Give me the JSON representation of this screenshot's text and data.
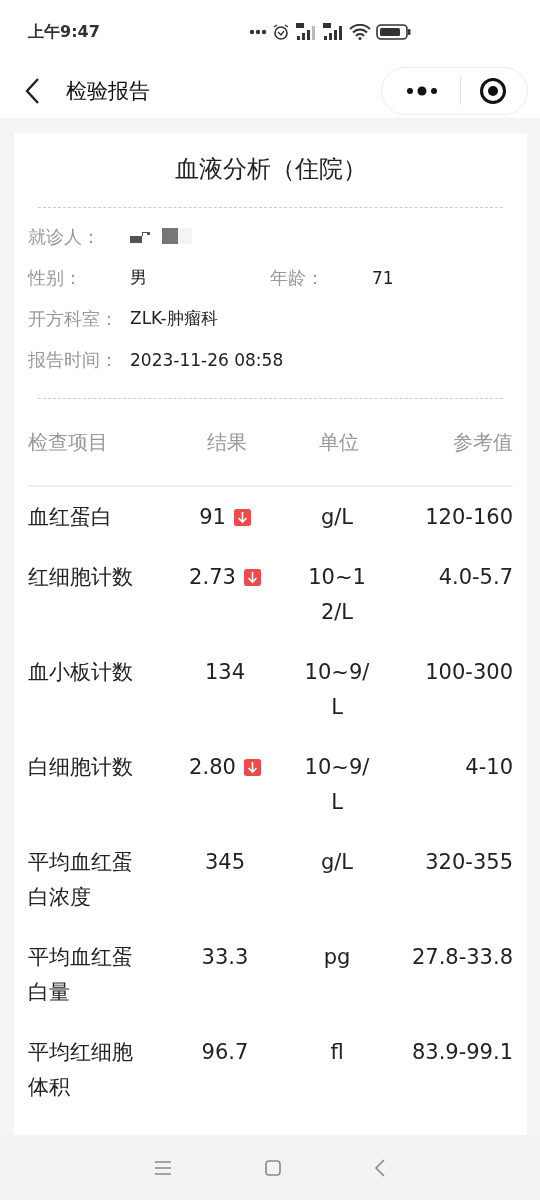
{
  "status_bar": {
    "time": "上午9:47"
  },
  "nav": {
    "title": "检验报告"
  },
  "report": {
    "title": "血液分析（住院）",
    "info": [
      {
        "label": "就诊人：",
        "kind": "redacted"
      },
      {
        "label": "性别：",
        "value": "男",
        "label2": "年龄：",
        "value2": "71",
        "kind": "pair"
      },
      {
        "label": "开方科室：",
        "value": "ZLK-肿瘤科",
        "kind": "text"
      },
      {
        "label": "报告时间：",
        "value": "2023-11-26 08:58",
        "kind": "text"
      }
    ],
    "columns": [
      "检查项目",
      "结果",
      "单位",
      "参考值"
    ],
    "rows": [
      {
        "item": "血红蛋白",
        "result": "91",
        "low": true,
        "unit": "g/L",
        "reference": "120-160"
      },
      {
        "item": "红细胞计数",
        "result": "2.73",
        "low": true,
        "unit": "10~12/L",
        "reference": "4.0-5.7"
      },
      {
        "item": "血小板计数",
        "result": "134",
        "low": false,
        "unit": "10~9/L",
        "reference": "100-300"
      },
      {
        "item": "白细胞计数",
        "result": "2.80",
        "low": true,
        "unit": "10~9/L",
        "reference": "4-10"
      },
      {
        "item": "平均血红蛋白浓度",
        "result": "345",
        "low": false,
        "unit": "g/L",
        "reference": "320-355"
      },
      {
        "item": "平均血红蛋白量",
        "result": "33.3",
        "low": false,
        "unit": "pg",
        "reference": "27.8-33.8"
      },
      {
        "item": "平均红细胞体积",
        "result": "96.7",
        "low": false,
        "unit": "fl",
        "reference": "83.9-99.1"
      }
    ]
  }
}
